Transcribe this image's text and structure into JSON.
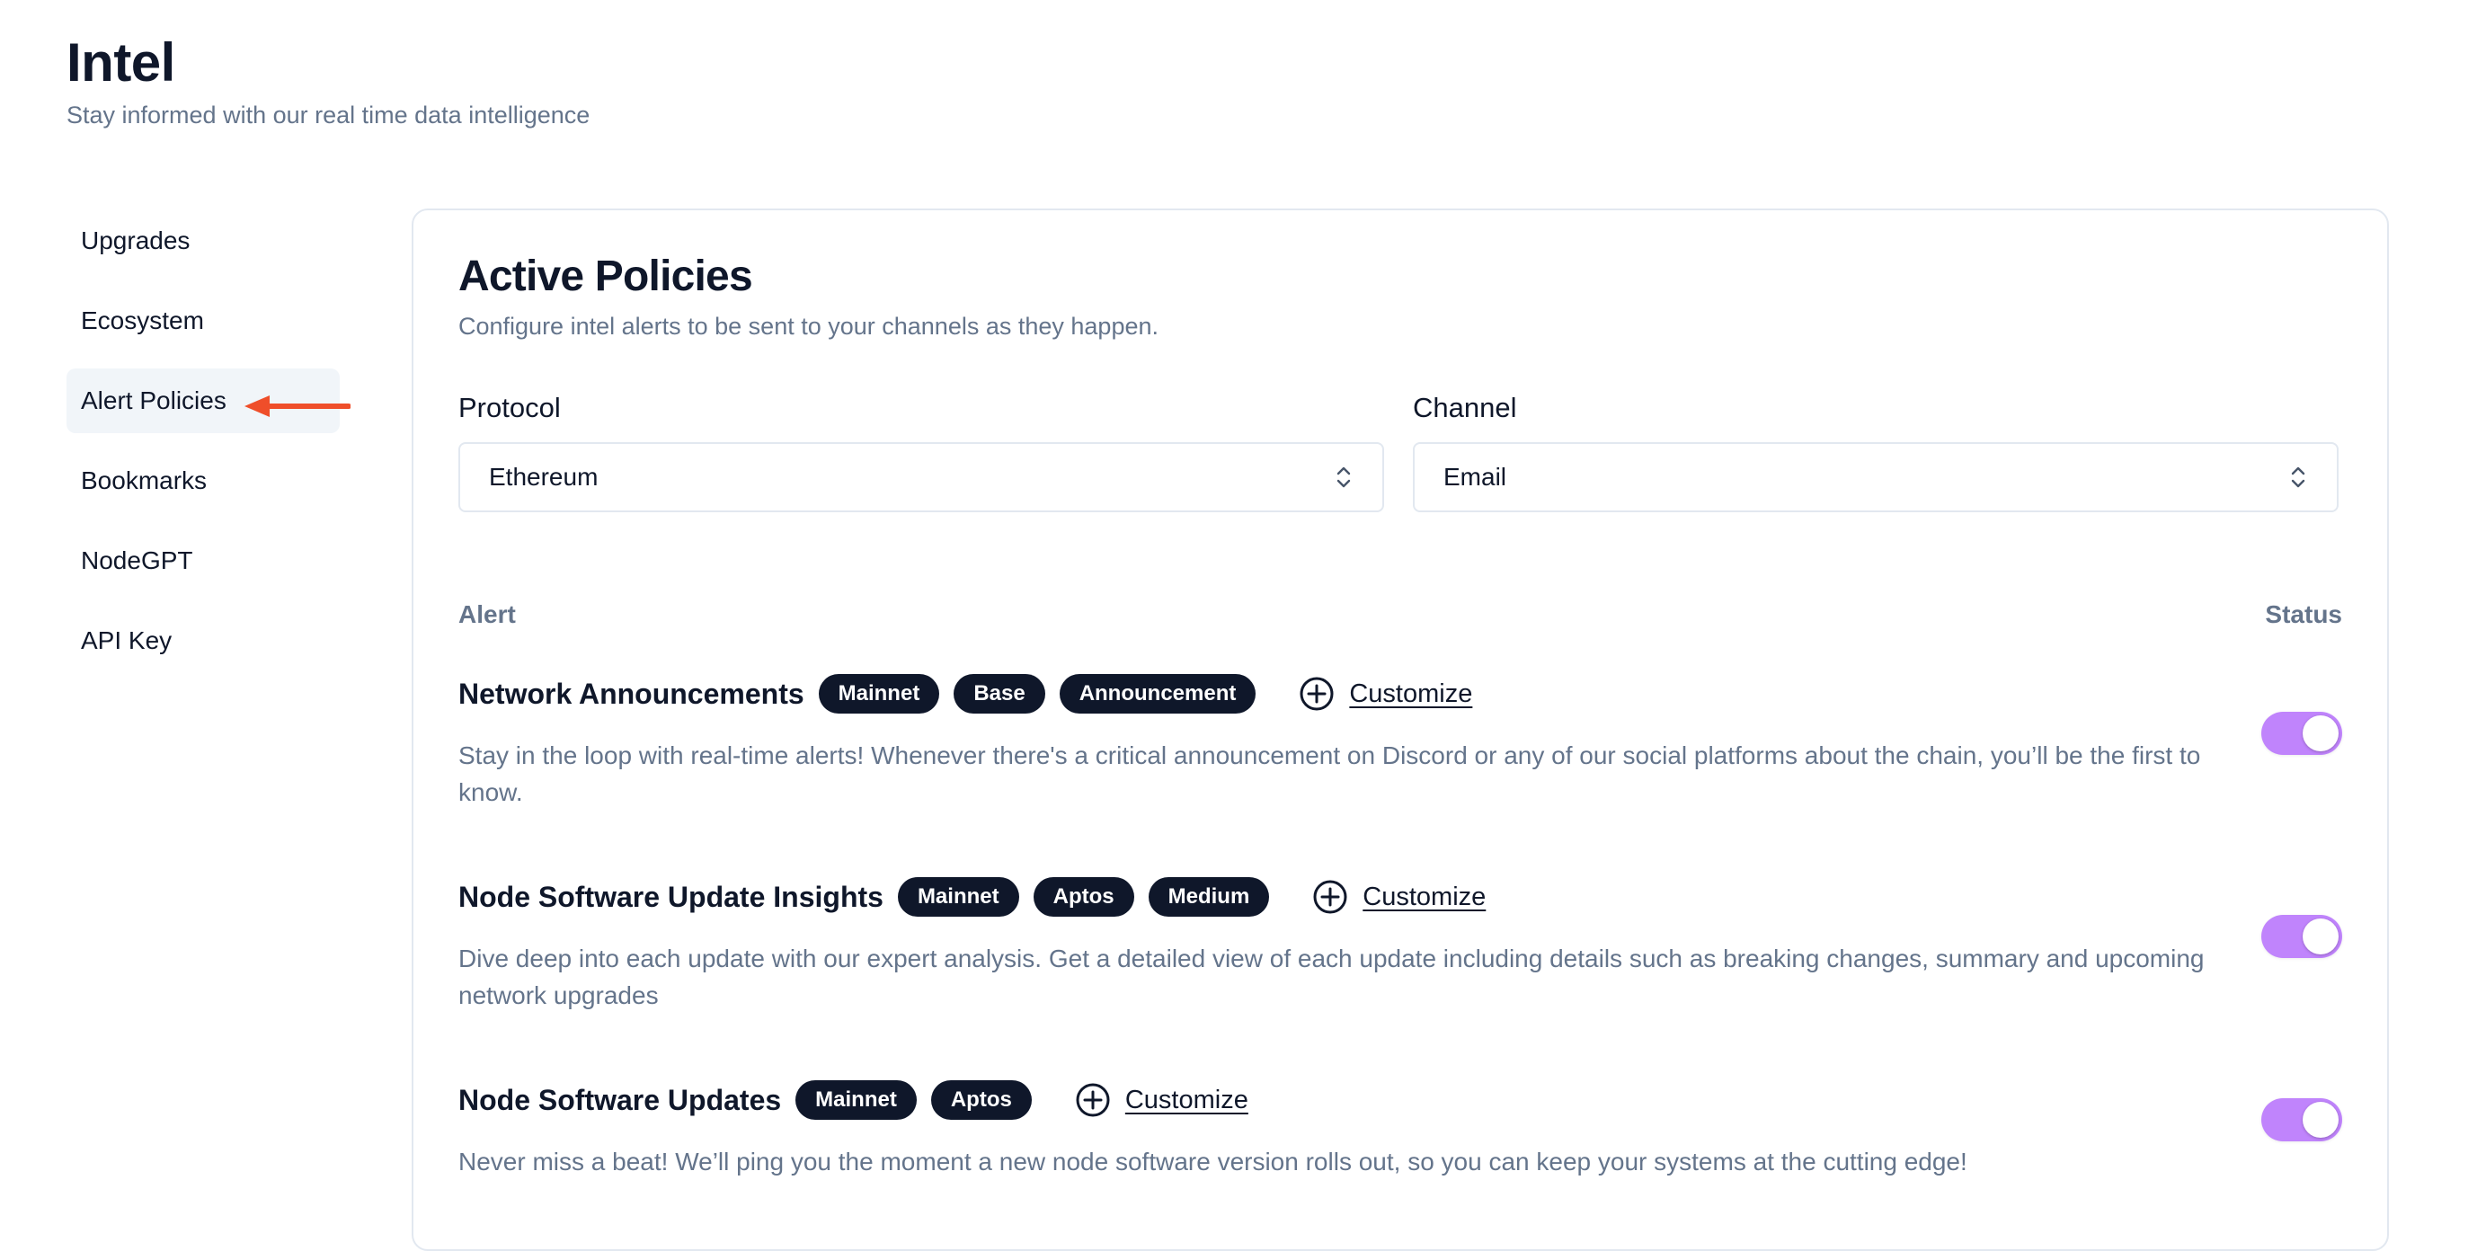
{
  "header": {
    "title": "Intel",
    "subtitle": "Stay informed with our real time data intelligence"
  },
  "sidebar": {
    "items": [
      {
        "label": "Upgrades",
        "active": false
      },
      {
        "label": "Ecosystem",
        "active": false
      },
      {
        "label": "Alert Policies",
        "active": true
      },
      {
        "label": "Bookmarks",
        "active": false
      },
      {
        "label": "NodeGPT",
        "active": false
      },
      {
        "label": "API Key",
        "active": false
      }
    ]
  },
  "card": {
    "title": "Active Policies",
    "subtitle": "Configure intel alerts to be sent to your channels as they happen."
  },
  "filters": {
    "protocol": {
      "label": "Protocol",
      "value": "Ethereum"
    },
    "channel": {
      "label": "Channel",
      "value": "Email"
    }
  },
  "table": {
    "alert_header": "Alert",
    "status_header": "Status"
  },
  "alerts": [
    {
      "title": "Network Announcements",
      "tags": [
        "Mainnet",
        "Base",
        "Announcement"
      ],
      "customize_label": "Customize",
      "description": "Stay in the loop with real-time alerts! Whenever there's a critical announcement on Discord or any of our social platforms about the chain, you’ll be the first to know.",
      "enabled": true
    },
    {
      "title": "Node Software Update Insights",
      "tags": [
        "Mainnet",
        "Aptos",
        "Medium"
      ],
      "customize_label": "Customize",
      "description": "Dive deep into each update with our expert analysis. Get a detailed view of each update including details such as breaking changes, summary and upcoming network upgrades",
      "enabled": true
    },
    {
      "title": "Node Software Updates",
      "tags": [
        "Mainnet",
        "Aptos"
      ],
      "customize_label": "Customize",
      "description": "Never miss a beat! We’ll ping you the moment a new node software version rolls out, so you can keep your systems at the cutting edge!",
      "enabled": true
    }
  ],
  "colors": {
    "text_primary": "#0f172a",
    "text_muted": "#64748b",
    "badge_bg": "#0f172a",
    "toggle_on": "#c084fc",
    "annotation_arrow": "#ef4e2a",
    "active_item_bg": "#f1f5f9"
  },
  "icons": {
    "select_chevron": "chevron-up-down-icon",
    "customize": "plus-circle-icon",
    "annotation": "arrow-left-icon"
  }
}
